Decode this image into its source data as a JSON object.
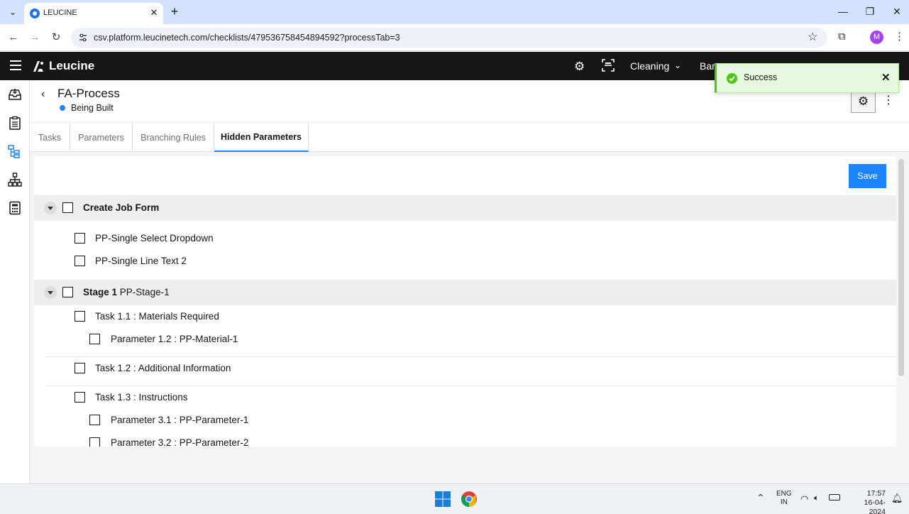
{
  "browser": {
    "tab_title": "LEUCINE",
    "url": "csv.platform.leucinetech.com/checklists/479536758454894592?processTab=3",
    "profile_initial": "M"
  },
  "header": {
    "logo_text": "Leucine",
    "facility": "Cleaning",
    "use_case": "Bar"
  },
  "toast": {
    "message": "Success"
  },
  "process": {
    "name": "FA-Process",
    "status": "Being Built"
  },
  "tabs": [
    {
      "label": "Tasks"
    },
    {
      "label": "Parameters"
    },
    {
      "label": "Branching Rules"
    },
    {
      "label": "Hidden Parameters"
    }
  ],
  "save_label": "Save",
  "tree": {
    "job_form": {
      "label": "Create Job Form",
      "items": [
        {
          "label": "PP-Single Select Dropdown"
        },
        {
          "label": "PP-Single Line Text 2"
        }
      ]
    },
    "stage": {
      "prefix": "Stage 1",
      "name": "PP-Stage-1",
      "tasks": [
        {
          "label": "Task 1.1 : Materials Required",
          "params": [
            {
              "label": "Parameter 1.2 : PP-Material-1"
            }
          ]
        },
        {
          "label": "Task 1.2 : Additional Information",
          "params": []
        },
        {
          "label": "Task 1.3 : Instructions",
          "params": [
            {
              "label": "Parameter 3.1 : PP-Parameter-1"
            },
            {
              "label": "Parameter 3.2 : PP-Parameter-2"
            }
          ]
        }
      ]
    }
  },
  "taskbar": {
    "lang_1": "ENG",
    "lang_2": "IN",
    "time": "17:57",
    "date": "16-04-2024"
  },
  "colors": {
    "primary": "#1d84ff",
    "header_bg": "#161616",
    "toast_bg": "#e8f8df",
    "success": "#52c41a"
  }
}
